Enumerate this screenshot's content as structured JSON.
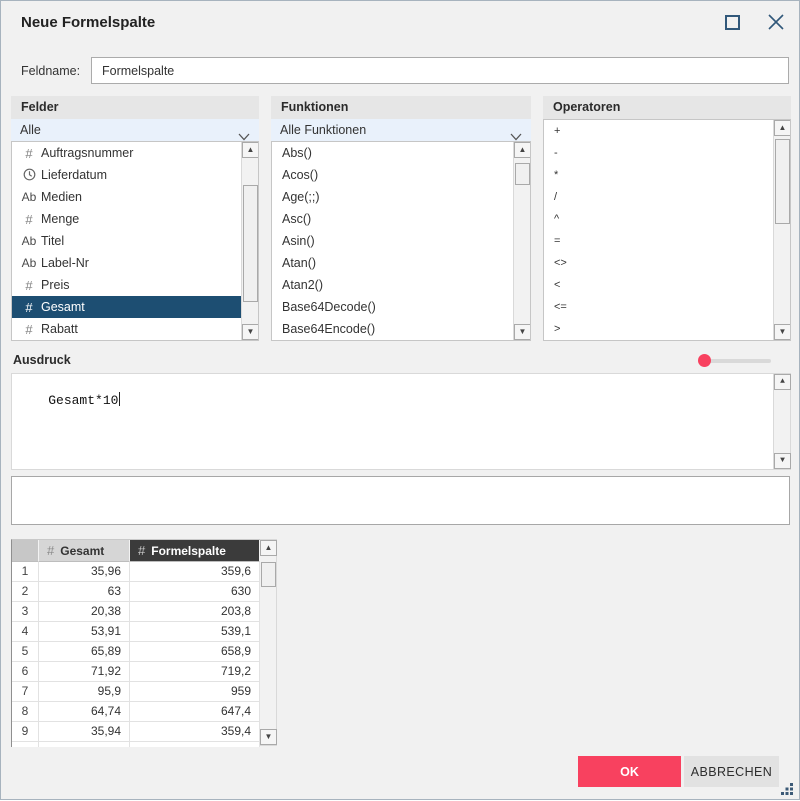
{
  "dialog": {
    "title": "Neue Formelspalte",
    "field_name_label": "Feldname:",
    "field_name_value": "Formelspalte"
  },
  "panels": {
    "fields": {
      "title": "Felder",
      "filter_value": "Alle",
      "items": [
        {
          "icon": "number",
          "label": "Auftragsnummer"
        },
        {
          "icon": "date",
          "label": "Lieferdatum"
        },
        {
          "icon": "text",
          "label": "Medien"
        },
        {
          "icon": "number",
          "label": "Menge"
        },
        {
          "icon": "text",
          "label": "Titel"
        },
        {
          "icon": "text",
          "label": "Label-Nr"
        },
        {
          "icon": "number",
          "label": "Preis"
        },
        {
          "icon": "number",
          "label": "Gesamt",
          "selected": true
        },
        {
          "icon": "number",
          "label": "Rabatt"
        }
      ]
    },
    "functions": {
      "title": "Funktionen",
      "filter_value": "Alle Funktionen",
      "items": [
        "Abs()",
        "Acos()",
        "Age(;;)",
        "Asc()",
        "Asin()",
        "Atan()",
        "Atan2()",
        "Base64Decode()",
        "Base64Encode()"
      ]
    },
    "operators": {
      "title": "Operatoren",
      "items": [
        "+",
        "-",
        "*",
        "/",
        "^",
        "=",
        "<>",
        "<",
        "<=",
        ">"
      ]
    }
  },
  "expression": {
    "label": "Ausdruck",
    "value": "Gesamt*10"
  },
  "preview_table": {
    "columns": [
      {
        "icon": "number",
        "label": "Gesamt",
        "highlighted": false
      },
      {
        "icon": "number",
        "label": "Formelspalte",
        "highlighted": true
      }
    ],
    "rows": [
      {
        "num": "1",
        "values": [
          "35,96",
          "359,6"
        ]
      },
      {
        "num": "2",
        "values": [
          "63",
          "630"
        ]
      },
      {
        "num": "3",
        "values": [
          "20,38",
          "203,8"
        ]
      },
      {
        "num": "4",
        "values": [
          "53,91",
          "539,1"
        ]
      },
      {
        "num": "5",
        "values": [
          "65,89",
          "658,9"
        ]
      },
      {
        "num": "6",
        "values": [
          "71,92",
          "719,2"
        ]
      },
      {
        "num": "7",
        "values": [
          "95,9",
          "959"
        ]
      },
      {
        "num": "8",
        "values": [
          "64,74",
          "647,4"
        ]
      },
      {
        "num": "9",
        "values": [
          "35,94",
          "359,4"
        ]
      }
    ]
  },
  "footer": {
    "ok_label": "OK",
    "cancel_label": "ABBRECHEN"
  },
  "colors": {
    "accent": "#f8415f",
    "selection": "#1d4e72",
    "header_dark": "#3b3b3b"
  }
}
